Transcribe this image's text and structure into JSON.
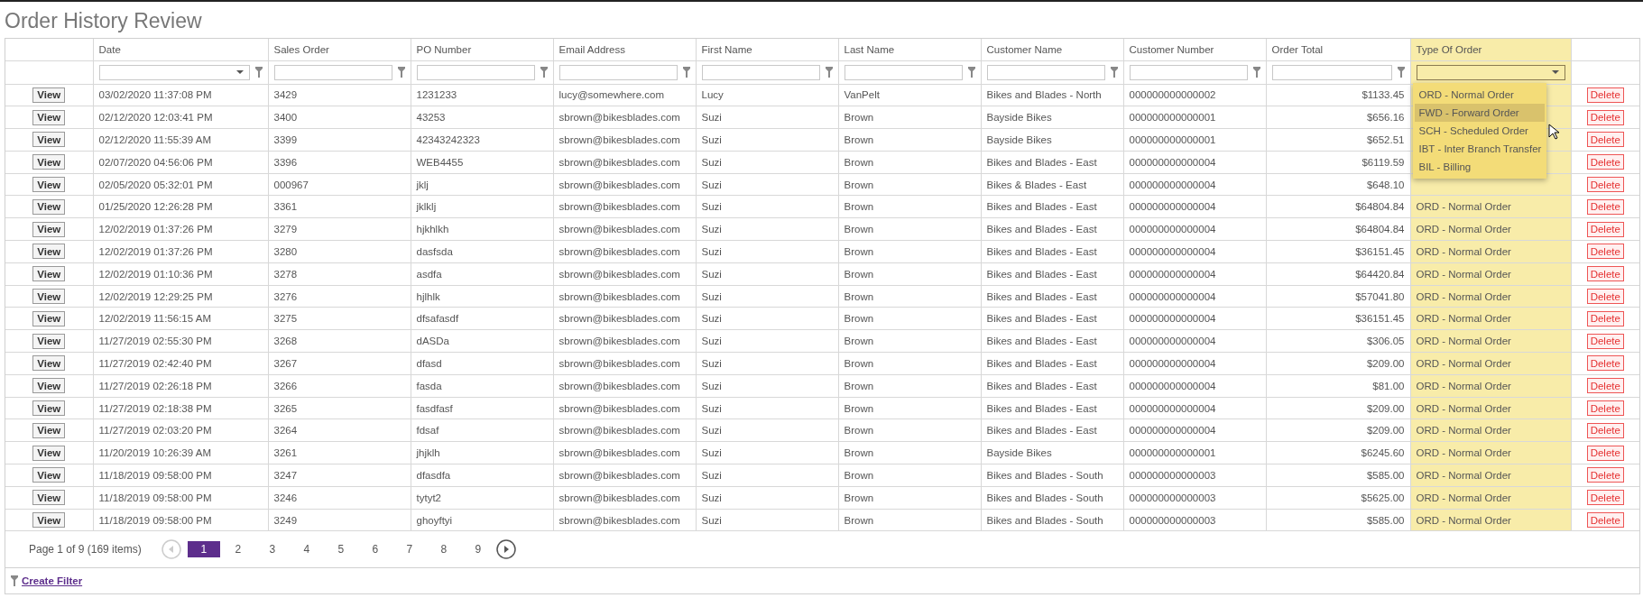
{
  "title": "Order History Review",
  "columns": [
    {
      "label": "Date",
      "kind": "date",
      "highlighted": false
    },
    {
      "label": "Sales Order",
      "kind": "text",
      "highlighted": false
    },
    {
      "label": "PO Number",
      "kind": "text",
      "highlighted": false
    },
    {
      "label": "Email Address",
      "kind": "text",
      "highlighted": false
    },
    {
      "label": "First Name",
      "kind": "text",
      "highlighted": false
    },
    {
      "label": "Last Name",
      "kind": "text",
      "highlighted": false
    },
    {
      "label": "Customer Name",
      "kind": "text",
      "highlighted": false
    },
    {
      "label": "Customer Number",
      "kind": "text",
      "highlighted": false
    },
    {
      "label": "Order Total",
      "kind": "text",
      "highlighted": false
    },
    {
      "label": "Type Of Order",
      "kind": "select",
      "highlighted": true
    }
  ],
  "type_dropdown": {
    "options": [
      {
        "label": "ORD - Normal Order",
        "selected": false
      },
      {
        "label": "FWD - Forward Order",
        "selected": true
      },
      {
        "label": "SCH - Scheduled Order",
        "selected": false
      },
      {
        "label": "IBT - Inter Branch Transfer",
        "selected": false
      },
      {
        "label": "BIL - Billing",
        "selected": false
      }
    ]
  },
  "rows": [
    {
      "view": "View",
      "delete": "Delete",
      "cells": [
        "03/02/2020 11:37:08 PM",
        "3429",
        "1231233",
        "lucy@somewhere.com",
        "Lucy",
        "VanPelt",
        "Bikes and Blades - North",
        "000000000000002",
        "$1133.45"
      ]
    },
    {
      "view": "View",
      "delete": "Delete",
      "cells": [
        "02/12/2020 12:03:41 PM",
        "3400",
        "43253",
        "sbrown@bikesblades.com",
        "Suzi",
        "Brown",
        "Bayside Bikes",
        "000000000000001",
        "$656.16"
      ]
    },
    {
      "view": "View",
      "delete": "Delete",
      "cells": [
        "02/12/2020 11:55:39 AM",
        "3399",
        "42343242323",
        "sbrown@bikesblades.com",
        "Suzi",
        "Brown",
        "Bayside Bikes",
        "000000000000001",
        "$652.51"
      ]
    },
    {
      "view": "View",
      "delete": "Delete",
      "cells": [
        "02/07/2020 04:56:06 PM",
        "3396",
        "WEB4455",
        "sbrown@bikesblades.com",
        "Suzi",
        "Brown",
        "Bikes and Blades - East",
        "000000000000004",
        "$6119.59"
      ]
    },
    {
      "view": "View",
      "delete": "Delete",
      "cells": [
        "02/05/2020 05:32:01 PM",
        "000967",
        "jklj",
        "sbrown@bikesblades.com",
        "Suzi",
        "Brown",
        "Bikes & Blades - East",
        "000000000000004",
        "$648.10"
      ]
    },
    {
      "view": "View",
      "delete": "Delete",
      "cells": [
        "01/25/2020 12:26:28 PM",
        "3361",
        "jklklj",
        "sbrown@bikesblades.com",
        "Suzi",
        "Brown",
        "Bikes and Blades - East",
        "000000000000004",
        "$64804.84",
        "ORD - Normal Order"
      ]
    },
    {
      "view": "View",
      "delete": "Delete",
      "cells": [
        "12/02/2019 01:37:26 PM",
        "3279",
        "hjkhlkh",
        "sbrown@bikesblades.com",
        "Suzi",
        "Brown",
        "Bikes and Blades - East",
        "000000000000004",
        "$64804.84",
        "ORD - Normal Order"
      ]
    },
    {
      "view": "View",
      "delete": "Delete",
      "cells": [
        "12/02/2019 01:37:26 PM",
        "3280",
        "dasfsda",
        "sbrown@bikesblades.com",
        "Suzi",
        "Brown",
        "Bikes and Blades - East",
        "000000000000004",
        "$36151.45",
        "ORD - Normal Order"
      ]
    },
    {
      "view": "View",
      "delete": "Delete",
      "cells": [
        "12/02/2019 01:10:36 PM",
        "3278",
        "asdfa",
        "sbrown@bikesblades.com",
        "Suzi",
        "Brown",
        "Bikes and Blades - East",
        "000000000000004",
        "$64420.84",
        "ORD - Normal Order"
      ]
    },
    {
      "view": "View",
      "delete": "Delete",
      "cells": [
        "12/02/2019 12:29:25 PM",
        "3276",
        "hjlhlk",
        "sbrown@bikesblades.com",
        "Suzi",
        "Brown",
        "Bikes and Blades - East",
        "000000000000004",
        "$57041.80",
        "ORD - Normal Order"
      ]
    },
    {
      "view": "View",
      "delete": "Delete",
      "cells": [
        "12/02/2019 11:56:15 AM",
        "3275",
        "dfsafasdf",
        "sbrown@bikesblades.com",
        "Suzi",
        "Brown",
        "Bikes and Blades - East",
        "000000000000004",
        "$36151.45",
        "ORD - Normal Order"
      ]
    },
    {
      "view": "View",
      "delete": "Delete",
      "cells": [
        "11/27/2019 02:55:30 PM",
        "3268",
        "dASDa",
        "sbrown@bikesblades.com",
        "Suzi",
        "Brown",
        "Bikes and Blades - East",
        "000000000000004",
        "$306.05",
        "ORD - Normal Order"
      ]
    },
    {
      "view": "View",
      "delete": "Delete",
      "cells": [
        "11/27/2019 02:42:40 PM",
        "3267",
        "dfasd",
        "sbrown@bikesblades.com",
        "Suzi",
        "Brown",
        "Bikes and Blades - East",
        "000000000000004",
        "$209.00",
        "ORD - Normal Order"
      ]
    },
    {
      "view": "View",
      "delete": "Delete",
      "cells": [
        "11/27/2019 02:26:18 PM",
        "3266",
        "fasda",
        "sbrown@bikesblades.com",
        "Suzi",
        "Brown",
        "Bikes and Blades - East",
        "000000000000004",
        "$81.00",
        "ORD - Normal Order"
      ]
    },
    {
      "view": "View",
      "delete": "Delete",
      "cells": [
        "11/27/2019 02:18:38 PM",
        "3265",
        "fasdfasf",
        "sbrown@bikesblades.com",
        "Suzi",
        "Brown",
        "Bikes and Blades - East",
        "000000000000004",
        "$209.00",
        "ORD - Normal Order"
      ]
    },
    {
      "view": "View",
      "delete": "Delete",
      "cells": [
        "11/27/2019 02:03:20 PM",
        "3264",
        "fdsaf",
        "sbrown@bikesblades.com",
        "Suzi",
        "Brown",
        "Bikes and Blades - East",
        "000000000000004",
        "$209.00",
        "ORD - Normal Order"
      ]
    },
    {
      "view": "View",
      "delete": "Delete",
      "cells": [
        "11/20/2019 10:26:39 AM",
        "3261",
        "jhjklh",
        "sbrown@bikesblades.com",
        "Suzi",
        "Brown",
        "Bayside Bikes",
        "000000000000001",
        "$6245.60",
        "ORD - Normal Order"
      ]
    },
    {
      "view": "View",
      "delete": "Delete",
      "cells": [
        "11/18/2019 09:58:00 PM",
        "3247",
        "dfasdfa",
        "sbrown@bikesblades.com",
        "Suzi",
        "Brown",
        "Bikes and Blades - South",
        "000000000000003",
        "$585.00",
        "ORD - Normal Order"
      ]
    },
    {
      "view": "View",
      "delete": "Delete",
      "cells": [
        "11/18/2019 09:58:00 PM",
        "3246",
        "tytyt2",
        "sbrown@bikesblades.com",
        "Suzi",
        "Brown",
        "Bikes and Blades - South",
        "000000000000003",
        "$5625.00",
        "ORD - Normal Order"
      ]
    },
    {
      "view": "View",
      "delete": "Delete",
      "cells": [
        "11/18/2019 09:58:00 PM",
        "3249",
        "ghoyftyi",
        "sbrown@bikesblades.com",
        "Suzi",
        "Brown",
        "Bikes and Blades - South",
        "000000000000003",
        "$585.00",
        "ORD - Normal Order"
      ]
    }
  ],
  "pager": {
    "summary": "Page 1 of 9 (169 items)",
    "prev_disabled": true,
    "next_disabled": false,
    "pages": [
      {
        "label": "1",
        "selected": true
      },
      {
        "label": "2",
        "selected": false
      },
      {
        "label": "3",
        "selected": false
      },
      {
        "label": "4",
        "selected": false
      },
      {
        "label": "5",
        "selected": false
      },
      {
        "label": "6",
        "selected": false
      },
      {
        "label": "7",
        "selected": false
      },
      {
        "label": "8",
        "selected": false
      },
      {
        "label": "9",
        "selected": false
      }
    ]
  },
  "create_filter": "Create Filter"
}
